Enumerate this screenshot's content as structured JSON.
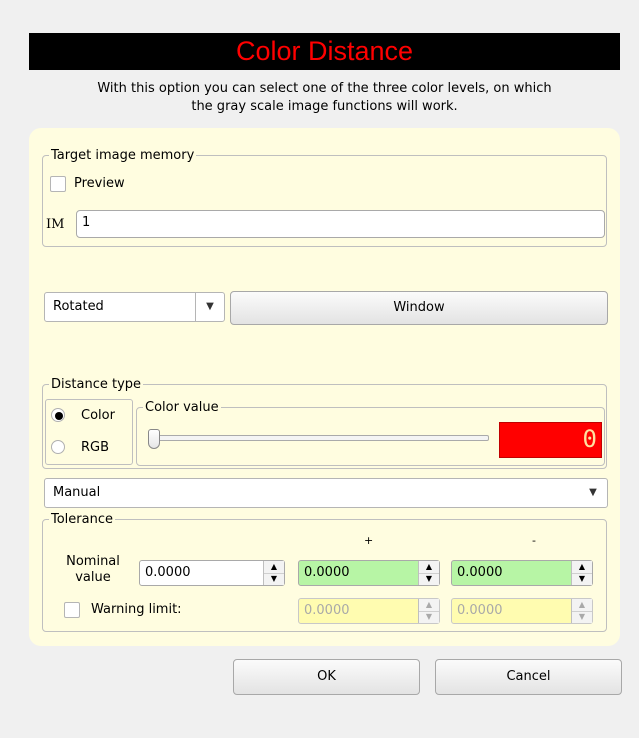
{
  "header": {
    "title": "Color Distance",
    "description_line1": "With this option you can select one of the three color levels, on which",
    "description_line2": "the gray scale image functions will work."
  },
  "target_image_memory": {
    "legend": "Target image memory",
    "preview_label": "Preview",
    "preview_checked": false,
    "im_label": "IM",
    "im_value": "1"
  },
  "rotation": {
    "selected": "Rotated",
    "window_button": "Window"
  },
  "distance_type": {
    "legend": "Distance type",
    "options": [
      "Color",
      "RGB"
    ],
    "selected": "Color",
    "color_value_legend": "Color value",
    "color_value": "0",
    "slider_fraction": 0.0,
    "display_color": "#ff0000"
  },
  "mode": {
    "selected": "Manual"
  },
  "tolerance": {
    "legend": "Tolerance",
    "plus_header": "+",
    "minus_header": "-",
    "nominal_label_line1": "Nominal",
    "nominal_label_line2": "value",
    "nominal_value": "0.0000",
    "plus_value": "0.0000",
    "minus_value": "0.0000",
    "warning_label": "Warning limit:",
    "warning_checked": false,
    "warning_plus": "0.0000",
    "warning_minus": "0.0000",
    "tolerance_color": "#b7f5a5",
    "warning_color": "#fffcb0"
  },
  "footer": {
    "ok_label": "OK",
    "cancel_label": "Cancel"
  }
}
